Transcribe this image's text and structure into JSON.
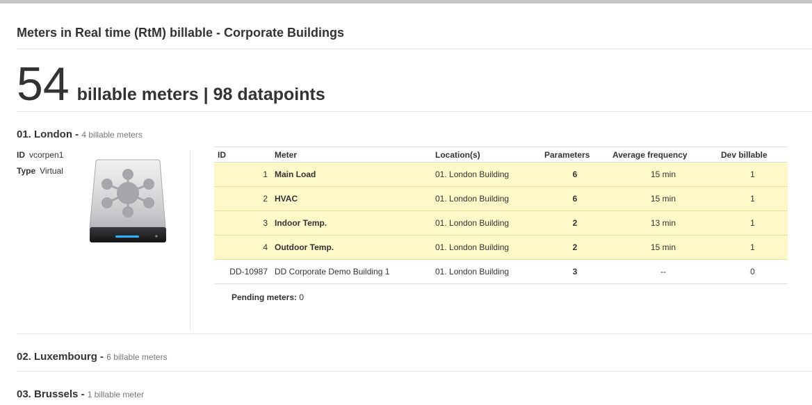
{
  "page": {
    "title": "Meters in Real time (RtM) billable - Corporate Buildings"
  },
  "summary": {
    "count": "54",
    "text": "billable meters | 98 datapoints"
  },
  "sections": [
    {
      "name": "01. London -",
      "sub": "4 billable meters"
    },
    {
      "name": "02. Luxembourg -",
      "sub": "6 billable meters"
    },
    {
      "name": "03. Brussels -",
      "sub": "1 billable meter"
    }
  ],
  "device": {
    "id_label": "ID",
    "id_value": "vcorpen1",
    "type_label": "Type",
    "type_value": "Virtual",
    "icon": "network-drive-icon"
  },
  "table": {
    "headers": [
      "ID",
      "Meter",
      "Location(s)",
      "Parameters",
      "Average frequency",
      "Dev billable"
    ],
    "rows": [
      {
        "id": "1",
        "meter": "Main Load",
        "location": "01. London Building",
        "params": "6",
        "freq": "15 min",
        "dev": "1"
      },
      {
        "id": "2",
        "meter": "HVAC",
        "location": "01. London Building",
        "params": "6",
        "freq": "15 min",
        "dev": "1"
      },
      {
        "id": "3",
        "meter": "Indoor Temp.",
        "location": "01. London Building",
        "params": "2",
        "freq": "13 min",
        "dev": "1"
      },
      {
        "id": "4",
        "meter": "Outdoor Temp.",
        "location": "01. London Building",
        "params": "2",
        "freq": "15 min",
        "dev": "1"
      },
      {
        "id": "DD-10987",
        "meter": "DD Corporate Demo Building 1",
        "location": "01. London Building",
        "params": "3",
        "freq": "--",
        "dev": "0"
      }
    ]
  },
  "pending": {
    "label": "Pending meters:",
    "value": "0"
  },
  "colors": {
    "highlight_row": "#fcf8c8",
    "param_green": "#5a9a1e"
  }
}
